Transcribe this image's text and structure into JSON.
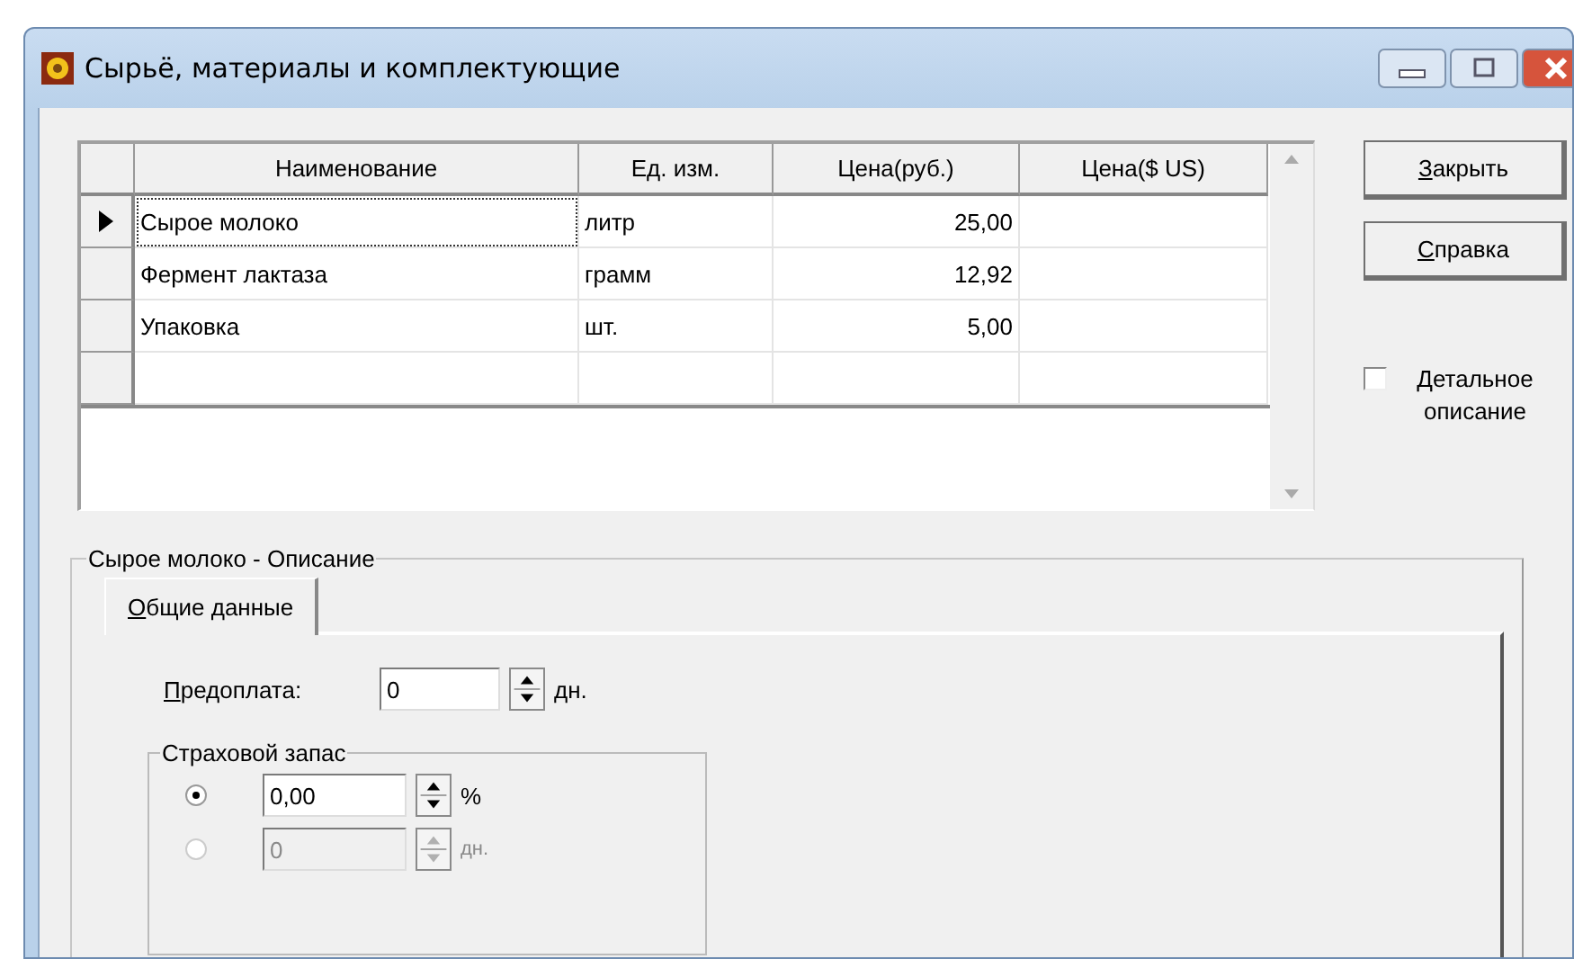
{
  "window": {
    "title": "Сырьё, материалы и комплектующие"
  },
  "grid": {
    "columns": [
      {
        "label": "Наименование",
        "kind": "text"
      },
      {
        "label": "Ед. изм.",
        "kind": "text"
      },
      {
        "label": "Цена(руб.)",
        "kind": "number"
      },
      {
        "label": "Цена($ US)",
        "kind": "number"
      }
    ],
    "rows": [
      {
        "selected": true,
        "cells": [
          "Сырое молоко",
          "литр",
          "25,00"
        ]
      },
      {
        "selected": false,
        "cells": [
          "Фермент лактаза",
          "грамм",
          "12,92"
        ]
      },
      {
        "selected": false,
        "cells": [
          "Упаковка",
          "шт.",
          "5,00"
        ]
      }
    ]
  },
  "buttons": [
    "Закрыть",
    "Справка"
  ],
  "detail_checkbox": {
    "label": "Детальное описание",
    "checked": false
  },
  "description": {
    "title": "Сырое молоко - Описание",
    "tabs": [
      {
        "label": "Общие данные",
        "selected": true
      }
    ],
    "prepayment": {
      "label": "Предоплата:",
      "value": "0",
      "unit": "дн."
    },
    "safety_stock": {
      "title": "Страховой запас",
      "options": [
        {
          "selected": true,
          "disabled": false,
          "value": "0,00",
          "unit": "%"
        },
        {
          "selected": false,
          "disabled": true,
          "value": "0",
          "unit": "дн."
        }
      ]
    }
  }
}
